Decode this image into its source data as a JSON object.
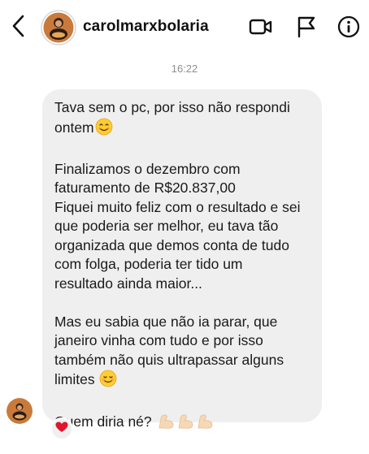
{
  "header": {
    "username": "carolmarxbolaria",
    "back_icon": "chevron-left-icon",
    "video_icon": "video-camera-icon",
    "flag_icon": "flag-icon",
    "info_icon": "info-icon"
  },
  "timestamp": "16:22",
  "message": {
    "lines_p1": [
      "Tava sem o pc, por isso não respondi",
      "ontem"
    ],
    "lines_p2": [
      "Finalizamos o dezembro com",
      "faturamento de R$20.837,00",
      "Fiquei muito feliz com o resultado e sei",
      "que poderia ser melhor, eu tava tão",
      "organizada que demos conta de tudo",
      "com folga, poderia ter tido um",
      "resultado ainda maior..."
    ],
    "lines_p3": [
      "Mas eu sabia que não ia parar, que",
      "janeiro vinha com tudo e por isso",
      "também não quis ultrapassar alguns",
      "limites"
    ],
    "last_line": "Quem diria né?"
  },
  "reaction": {
    "icon": "heart-icon",
    "color": "#e0152e"
  },
  "colors": {
    "bubble_bg": "#efefef",
    "timestamp": "#8e8e8e",
    "text": "#1a1a1a"
  }
}
